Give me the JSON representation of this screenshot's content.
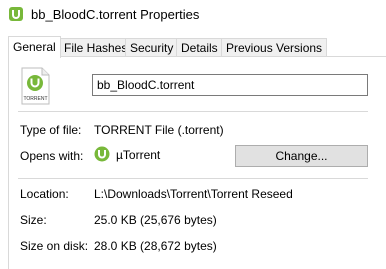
{
  "window": {
    "title": "bb_BloodC.torrent Properties"
  },
  "tabs": [
    {
      "label": "General"
    },
    {
      "label": "File Hashes"
    },
    {
      "label": "Security"
    },
    {
      "label": "Details"
    },
    {
      "label": "Previous Versions"
    }
  ],
  "general": {
    "file_icon_caption": "TORRENT",
    "filename": "bb_BloodC.torrent",
    "type_label": "Type of file:",
    "type_value": "TORRENT File (.torrent)",
    "opens_label": "Opens with:",
    "opens_value": "µTorrent",
    "change_label": "Change...",
    "location_label": "Location:",
    "location_value": "L:\\Downloads\\Torrent\\Torrent Reseed",
    "size_label": "Size:",
    "size_value": "25.0 KB (25,676 bytes)",
    "size_on_disk_label": "Size on disk:",
    "size_on_disk_value": "28.0 KB (28,672 bytes)"
  },
  "colors": {
    "utorrent_green": "#78b83a",
    "panel_border": "#d9d9d9"
  }
}
